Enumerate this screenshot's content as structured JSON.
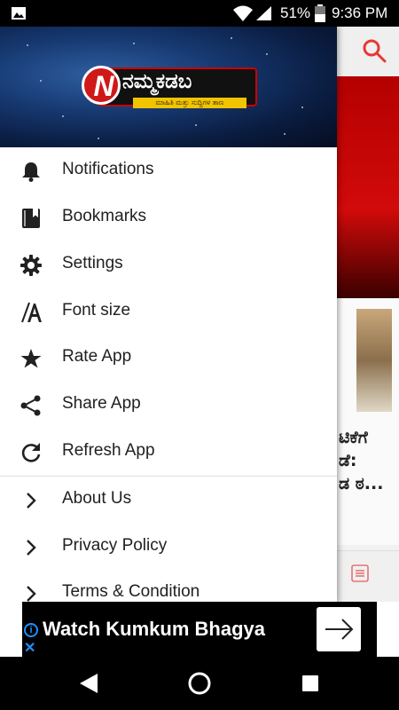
{
  "status_bar": {
    "battery": "51%",
    "time": "9:36 PM"
  },
  "drawer": {
    "logo": {
      "text": "ನಮ್ಮಕಡಬ",
      "tagline": "ಮಾಹಿತಿ ಮತ್ತು ಸುದ್ದಿಗಳ ತಾಣ"
    },
    "items": [
      {
        "label": "Notifications",
        "icon": "bell-icon"
      },
      {
        "label": "Bookmarks",
        "icon": "bookmark-icon"
      },
      {
        "label": "Settings",
        "icon": "gear-icon"
      },
      {
        "label": "Font size",
        "icon": "font-size-icon"
      },
      {
        "label": "Rate App",
        "icon": "star-icon"
      },
      {
        "label": "Share App",
        "icon": "share-icon"
      },
      {
        "label": "Refresh App",
        "icon": "refresh-icon"
      },
      {
        "label": "About Us",
        "icon": "chevron-right-icon"
      },
      {
        "label": "Privacy Policy",
        "icon": "chevron-right-icon"
      },
      {
        "label": "Terms & Condition",
        "icon": "chevron-right-icon"
      }
    ]
  },
  "background": {
    "headline": "ಟಿಕೆಗೆ\nಡೆ:\nಡ ಠ..."
  },
  "ad": {
    "text": "Watch Kumkum Bhagya"
  },
  "colors": {
    "accent": "#d01818",
    "search_icon": "#e53935"
  }
}
